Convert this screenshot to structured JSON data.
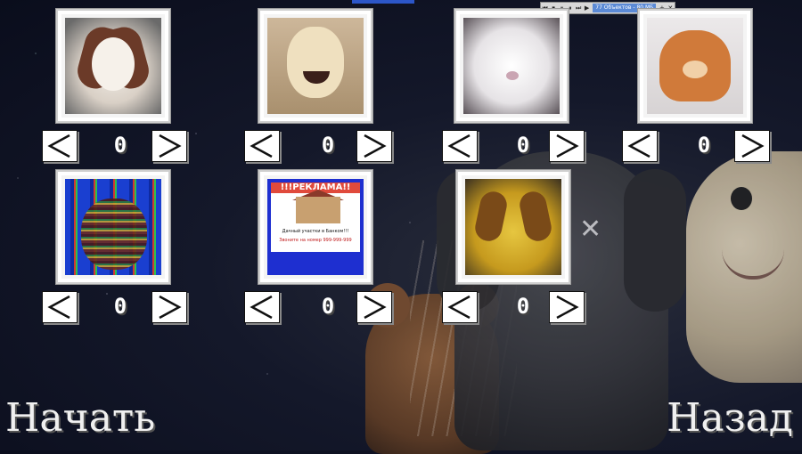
{
  "toolbar": {
    "status": "77 Объектов - 80 МБ",
    "buttons": [
      "⏮",
      "⏹",
      "⏸",
      "⏸",
      "⏭",
      "▶"
    ],
    "extra": [
      "+",
      "✕"
    ]
  },
  "items": [
    {
      "id": "cream-dog",
      "count": "0"
    },
    {
      "id": "lamb",
      "count": "0"
    },
    {
      "id": "white-bear",
      "count": "0"
    },
    {
      "id": "orange-bear",
      "count": "0"
    },
    {
      "id": "glitch",
      "count": "0"
    },
    {
      "id": "ad",
      "count": "0",
      "ad_title": "!!!РЕКЛАМА!!",
      "ad_text": "Дачный участки в Банком!!!",
      "ad_phone": "Звоните на номер 999-999-999"
    },
    {
      "id": "yellow-dog",
      "count": "0"
    }
  ],
  "menu": {
    "start": "Начать",
    "back": "Назад"
  }
}
